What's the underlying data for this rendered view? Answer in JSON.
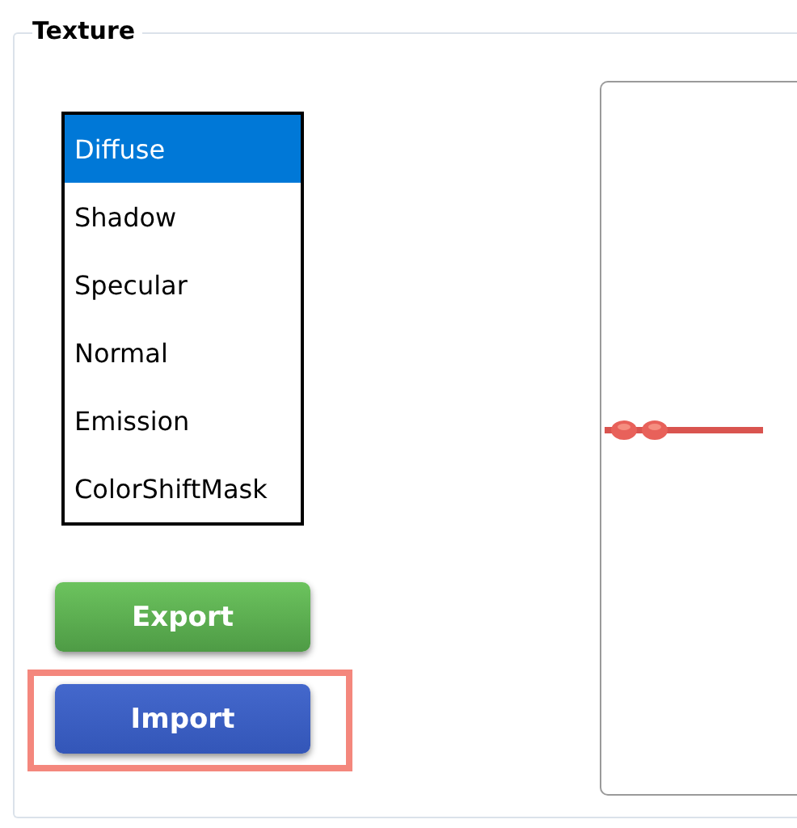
{
  "group": {
    "title": "Texture"
  },
  "texture_list": [
    {
      "label": "Diffuse",
      "selected": true
    },
    {
      "label": "Shadow",
      "selected": false
    },
    {
      "label": "Specular",
      "selected": false
    },
    {
      "label": "Normal",
      "selected": false
    },
    {
      "label": "Emission",
      "selected": false
    },
    {
      "label": "ColorShiftMask",
      "selected": false
    }
  ],
  "buttons": [
    {
      "label": "Export",
      "kind": "export",
      "highlighted": false
    },
    {
      "label": "Import",
      "kind": "import",
      "highlighted": true
    }
  ]
}
